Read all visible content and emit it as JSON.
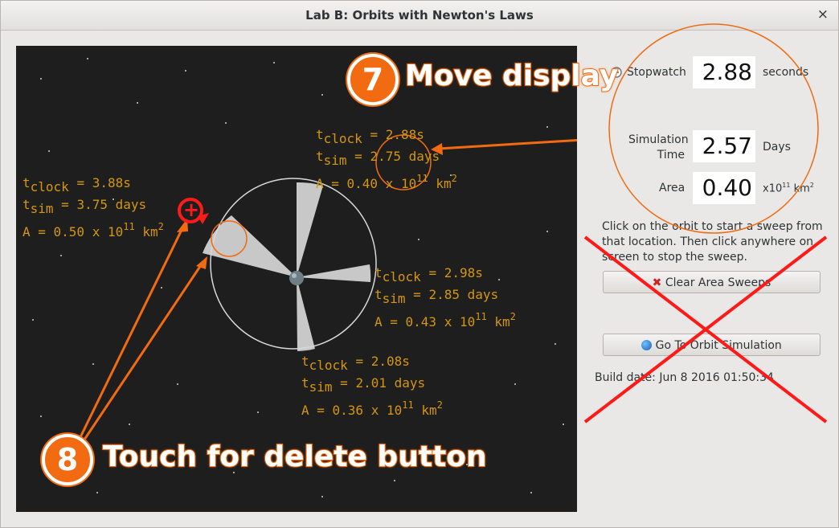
{
  "window": {
    "title": "Lab B: Orbits with Newton's Laws",
    "close_glyph": "×"
  },
  "sweeps": [
    {
      "t_clock": "3.88s",
      "t_sim": "3.75 days",
      "area": "0.50 x 10",
      "exp": "11",
      "unit": "km",
      "unit_exp": "2"
    },
    {
      "t_clock": "2.88s",
      "t_sim": "2.75 days",
      "area": "0.40 x 10",
      "exp": "11",
      "unit": "km",
      "unit_exp": "2"
    },
    {
      "t_clock": "2.98s",
      "t_sim": "2.85 days",
      "area": "0.43 x 10",
      "exp": "11",
      "unit": "km",
      "unit_exp": "2"
    },
    {
      "t_clock": "2.08s",
      "t_sim": "2.01 days",
      "area": "0.36 x 10",
      "exp": "11",
      "unit": "km",
      "unit_exp": "2"
    }
  ],
  "labels": {
    "t_clock_prefix": "t",
    "clock_sub": "clock",
    "sim_sub": "sim",
    "eq": " = ",
    "area_prefix": "A = "
  },
  "panel": {
    "stopwatch_label": "Stopwatch",
    "stopwatch_value": "2.88",
    "stopwatch_unit": "seconds",
    "simtime_label_1": "Simulation",
    "simtime_label_2": "Time",
    "simtime_value": "2.57",
    "simtime_unit": "Days",
    "area_label": "Area",
    "area_value": "0.40",
    "area_unit_base": "x10",
    "area_unit_exp": "11",
    "area_unit_km": " km",
    "area_unit_km_exp": "2",
    "instructions": "Click on the orbit to start a sweep from that location. Then click anywhere on screen to stop the sweep.",
    "clear_button": "Clear Area Sweeps",
    "goto_button": "Go To Orbit Simulation",
    "build_date": "Build date: Jun  8 2016 01:50:34"
  },
  "annotations": {
    "badge7": "7",
    "callout7": "Move display",
    "badge8": "8",
    "callout8": "Touch for delete button",
    "delete_glyph": "+",
    "accent": "#f26b11",
    "cross_color": "#ff1a1a"
  },
  "icons": [
    "clock-icon",
    "clear-x-icon",
    "globe-icon",
    "close-icon",
    "planet-icon",
    "delete-icon"
  ]
}
